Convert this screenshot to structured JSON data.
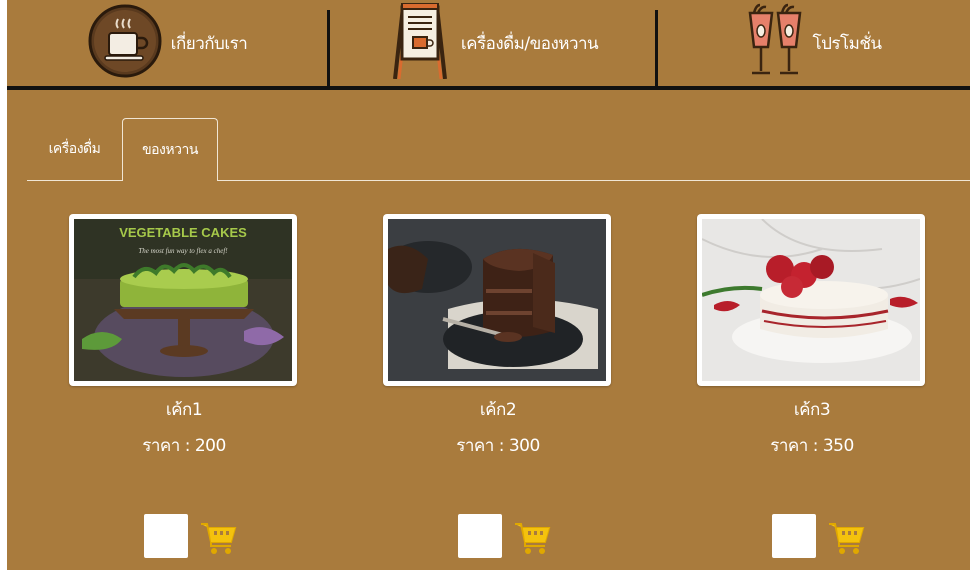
{
  "nav": {
    "items": [
      {
        "label": "เกี่ยวกับเรา",
        "icon": "coffee-cup-icon"
      },
      {
        "label": "เครื่องดื่ม/ของหวาน",
        "icon": "menu-board-icon"
      },
      {
        "label": "โปรโมชั่น",
        "icon": "drinks-icon"
      }
    ]
  },
  "tabs": {
    "items": [
      {
        "label": "เครื่องดื่ม",
        "active": false
      },
      {
        "label": "ของหวาน",
        "active": true
      }
    ]
  },
  "products": [
    {
      "name": "เค้ก1",
      "price": "ราคา : 200",
      "image_text": "VEGETABLE CAKES",
      "image_subtext": "The most fun way to flex a chef!",
      "quantity": ""
    },
    {
      "name": "เค้ก2",
      "price": "ราคา : 300",
      "quantity": ""
    },
    {
      "name": "เค้ก3",
      "price": "ราคา : 350",
      "quantity": ""
    }
  ],
  "colors": {
    "background": "#a97b3d",
    "nav_rule": "#111111",
    "text": "#ffffff",
    "cart": "#f4c20d"
  }
}
